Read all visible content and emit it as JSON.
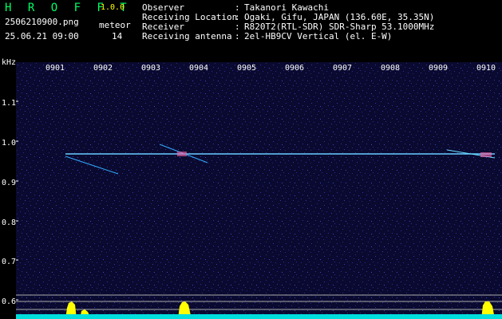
{
  "header": {
    "app_title": "H R O F F T",
    "app_version": "1.0.0",
    "filename": "2506210900.png",
    "timestamp": "25.06.21 09:00",
    "meteor_label": "meteor",
    "meteor_count": "14"
  },
  "info": [
    {
      "key": "Observer",
      "sep": ":",
      "value": "Takanori Kawachi"
    },
    {
      "key": "Receiving Location",
      "sep": ":",
      "value": "Ogaki, Gifu, JAPAN (136.60E, 35.35N)"
    },
    {
      "key": "Receiver",
      "sep": ":",
      "value": "R820T2(RTL-SDR) SDR-Sharp 53.1000MHz"
    },
    {
      "key": "Receiving antenna",
      "sep": ":",
      "value": "2el-HB9CV Vertical (el. E-W)"
    }
  ],
  "axes": {
    "unit": "kHz",
    "y_ticks": [
      "1.1",
      "1.0",
      "0.9",
      "0.8",
      "0.7",
      "0.6"
    ],
    "x_ticks": [
      "0901",
      "0902",
      "0903",
      "0904",
      "0905",
      "0906",
      "0907",
      "0908",
      "0909",
      "0910"
    ]
  },
  "colors": {
    "title_green": "#00ff66",
    "version_yellow": "#ffff00",
    "background_blue": "#0a0a30",
    "trace_cyan": "#66ccff",
    "activity_yellow": "#ffff00"
  }
}
